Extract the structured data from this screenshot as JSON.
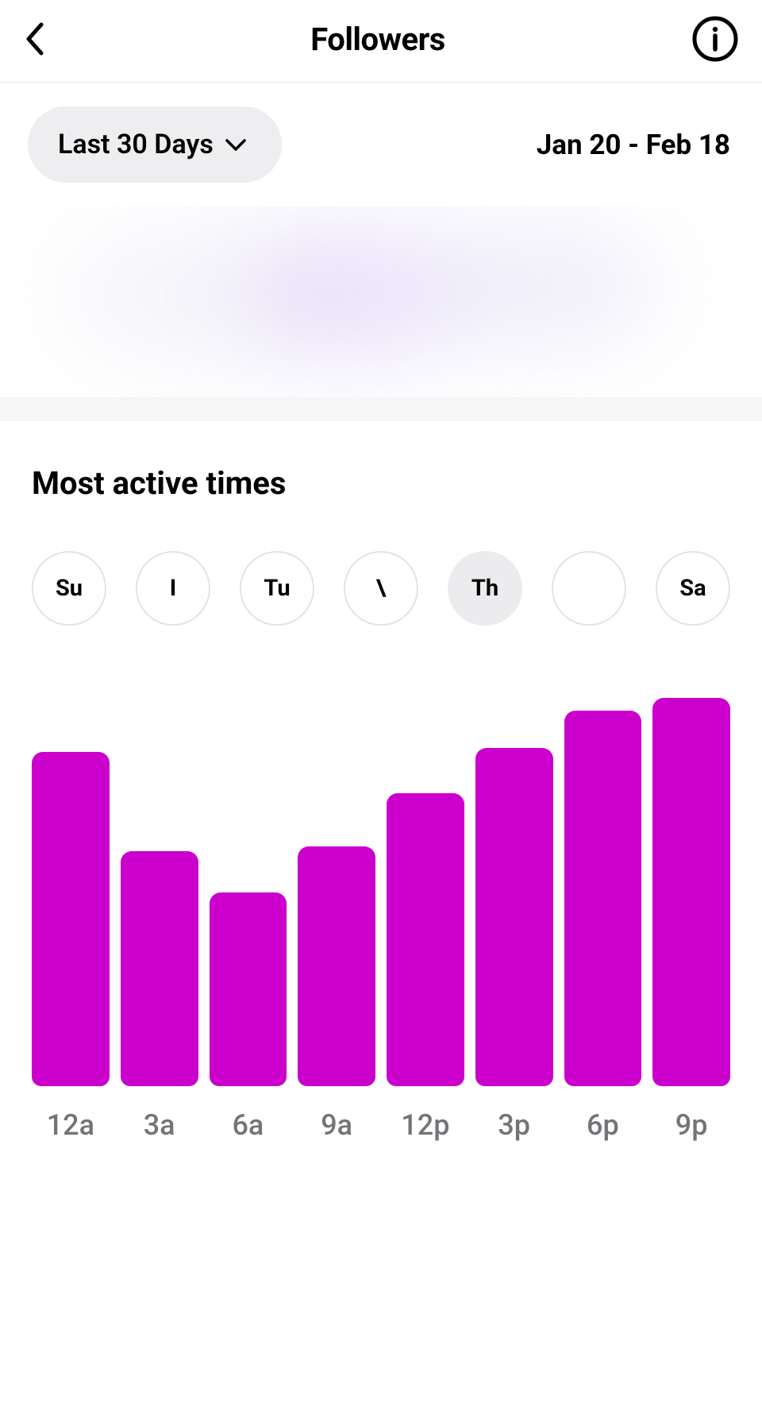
{
  "header": {
    "title": "Followers"
  },
  "filter": {
    "period_label": "Last 30 Days",
    "date_range": "Jan 20 - Feb 18"
  },
  "section": {
    "title": "Most active times"
  },
  "days": [
    {
      "label": "Su",
      "selected": false
    },
    {
      "label": "I",
      "selected": false
    },
    {
      "label": "Tu",
      "selected": false
    },
    {
      "label": "\\",
      "selected": false
    },
    {
      "label": "Th",
      "selected": true
    },
    {
      "label": "",
      "selected": false
    },
    {
      "label": "Sa",
      "selected": false
    }
  ],
  "chart_data": {
    "type": "bar",
    "title": "Most active times",
    "xlabel": "",
    "ylabel": "",
    "categories": [
      "12a",
      "3a",
      "6a",
      "9a",
      "12p",
      "3p",
      "6p",
      "9p"
    ],
    "values": [
      81,
      57,
      47,
      58,
      71,
      82,
      91,
      94
    ],
    "ylim": [
      0,
      100
    ],
    "color": "#cc00cc"
  }
}
